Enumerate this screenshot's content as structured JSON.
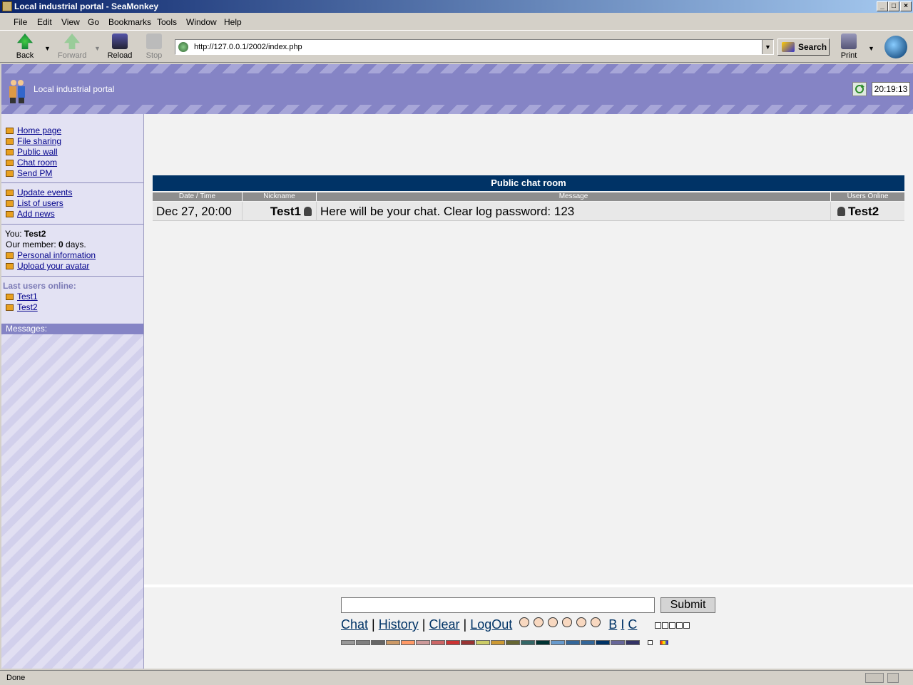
{
  "window": {
    "title": "Local industrial portal - SeaMonkey"
  },
  "menu": [
    "File",
    "Edit",
    "View",
    "Go",
    "Bookmarks",
    "Tools",
    "Window",
    "Help"
  ],
  "toolbar": {
    "back": "Back",
    "forward": "Forward",
    "reload": "Reload",
    "stop": "Stop",
    "url": "http://127.0.0.1/2002/index.php",
    "search": "Search",
    "print": "Print"
  },
  "header": {
    "site_title": "Local industrial portal",
    "clock": "20:19:13"
  },
  "sidebar": {
    "nav": [
      "Home page",
      "File sharing",
      "Public wall",
      "Chat room",
      "Send PM"
    ],
    "tools": [
      "Update events",
      "List of users",
      "Add news"
    ],
    "you_label": "You: ",
    "you_name": "Test2",
    "member_prefix": "Our member: ",
    "member_days": "0",
    "member_suffix": " days.",
    "account": [
      "Personal information",
      "Upload your avatar"
    ],
    "last_users_label": "Last users online:",
    "last_users": [
      "Test1",
      "Test2"
    ],
    "messages_label": "Messages:"
  },
  "chat": {
    "title": "Public chat room",
    "columns": [
      "Date / Time",
      "Nickname",
      "Message",
      "Users Online"
    ],
    "row": {
      "datetime": "Dec 27, 20:00",
      "nickname": "Test1",
      "message": "Here will be your chat. Clear log password: 123",
      "online": "Test2"
    },
    "submit": "Submit",
    "links": [
      "Chat",
      "History",
      "Clear",
      "LogOut"
    ],
    "format": [
      "B",
      "I",
      "C"
    ],
    "separator": "|",
    "colors": [
      "#999999",
      "#808080",
      "#666666",
      "#cc9966",
      "#ff9966",
      "#cc9999",
      "#cc6666",
      "#cc3333",
      "#993333",
      "#cccc66",
      "#cc9933",
      "#666633",
      "#336666",
      "#003333",
      "#6699cc",
      "#336699",
      "#336699",
      "#003366",
      "#666699",
      "#333366"
    ]
  },
  "status": {
    "text": "Done"
  }
}
